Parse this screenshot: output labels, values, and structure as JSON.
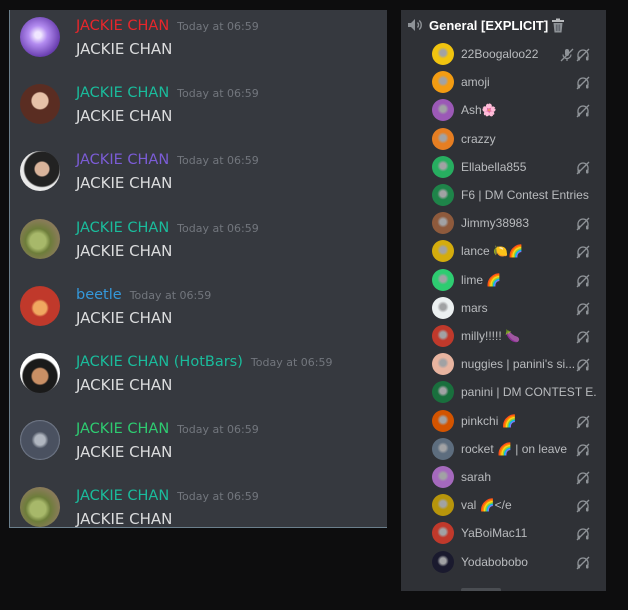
{
  "chat": {
    "messages": [
      {
        "author": "JACKIE CHAN",
        "author_color": "#e8262b",
        "time": "Today at 06:59",
        "text": "JACKIE CHAN",
        "avatar": "purple-lightning-avatar"
      },
      {
        "author": "JACKIE CHAN",
        "author_color": "#1abc9c",
        "time": "Today at 06:59",
        "text": "JACKIE CHAN",
        "avatar": "woman-photo-avatar"
      },
      {
        "author": "JACKIE CHAN",
        "author_color": "#7b5cd6",
        "time": "Today at 06:59",
        "text": "JACKIE CHAN",
        "avatar": "man-photo-avatar"
      },
      {
        "author": "JACKIE CHAN",
        "author_color": "#1abc9c",
        "time": "Today at 06:59",
        "text": "JACKIE CHAN",
        "avatar": "yoda-avatar"
      },
      {
        "author": "beetle",
        "author_color": "#3498db",
        "time": "Today at 06:59",
        "text": "JACKIE CHAN",
        "avatar": "lion-cartoon-avatar"
      },
      {
        "author": "JACKIE CHAN (HotBars)",
        "author_color": "#1abc9c",
        "time": "Today at 06:59",
        "text": "JACKIE CHAN",
        "avatar": "cartoon-boy-avatar"
      },
      {
        "author": "JACKIE CHAN",
        "author_color": "#2ecc71",
        "time": "Today at 06:59",
        "text": "JACKIE CHAN",
        "avatar": "knight-avatar"
      },
      {
        "author": "JACKIE CHAN",
        "author_color": "#1abc9c",
        "time": "Today at 06:59",
        "text": "JACKIE CHAN",
        "avatar": "yoda-avatar"
      }
    ]
  },
  "voice_channel": {
    "title": "General [EXPLICIT]",
    "icon": "speaker-icon",
    "trash_icon": "trash-icon",
    "members": [
      {
        "name": "22Boogaloo22",
        "muted": true,
        "deafened": true,
        "avatar_color": "#f1c40f"
      },
      {
        "name": "amoji",
        "muted": false,
        "deafened": true,
        "avatar_color": "#f39c12"
      },
      {
        "name": "Ash🌸",
        "muted": false,
        "deafened": true,
        "avatar_color": "#9b59b6"
      },
      {
        "name": "crazzy",
        "muted": false,
        "deafened": false,
        "avatar_color": "#e67e22"
      },
      {
        "name": "Ellabella855",
        "muted": false,
        "deafened": true,
        "avatar_color": "#27ae60"
      },
      {
        "name": "F6 | DM Contest Entries",
        "muted": false,
        "deafened": false,
        "avatar_color": "#1e8449"
      },
      {
        "name": "Jimmy38983",
        "muted": false,
        "deafened": true,
        "avatar_color": "#8e5a3c"
      },
      {
        "name": "lance 🍋🌈",
        "muted": false,
        "deafened": true,
        "avatar_color": "#d4ac0d"
      },
      {
        "name": "lime 🌈",
        "muted": false,
        "deafened": true,
        "avatar_color": "#2ecc71"
      },
      {
        "name": "mars",
        "muted": false,
        "deafened": true,
        "avatar_color": "#ecf0f1"
      },
      {
        "name": "milly!!!!! 🍆",
        "muted": false,
        "deafened": true,
        "avatar_color": "#c0392b"
      },
      {
        "name": "nuggies | panini's si...",
        "muted": false,
        "deafened": true,
        "avatar_color": "#e8b4a0"
      },
      {
        "name": "panini | DM CONTEST E...",
        "muted": false,
        "deafened": false,
        "avatar_color": "#196f3d"
      },
      {
        "name": "pinkchi 🌈",
        "muted": false,
        "deafened": true,
        "avatar_color": "#d35400"
      },
      {
        "name": "rocket 🌈 | on leave",
        "muted": false,
        "deafened": true,
        "avatar_color": "#5d6d7e"
      },
      {
        "name": "sarah",
        "muted": false,
        "deafened": true,
        "avatar_color": "#a569bd"
      },
      {
        "name": "val 🌈</e",
        "muted": false,
        "deafened": true,
        "avatar_color": "#b7950b"
      },
      {
        "name": "YaBoiMac11",
        "muted": false,
        "deafened": true,
        "avatar_color": "#c0392b"
      },
      {
        "name": "Yodabobobo",
        "muted": false,
        "deafened": true,
        "avatar_color": "#1a1a2e"
      }
    ]
  }
}
